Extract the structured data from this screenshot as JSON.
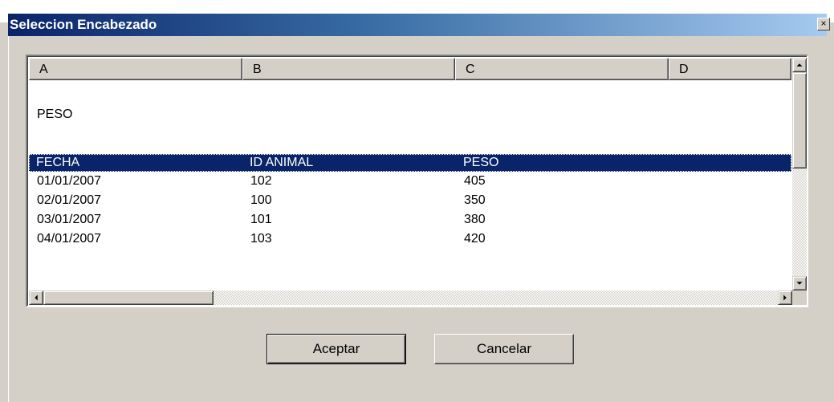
{
  "window": {
    "title": "Seleccion Encabezado",
    "close_label": "×"
  },
  "listview": {
    "columns": [
      "A",
      "B",
      "C",
      "D"
    ],
    "rows": [
      [
        "",
        "",
        ""
      ],
      [
        "PESO",
        "",
        ""
      ],
      [
        "",
        "",
        ""
      ],
      [
        "FECHA",
        "ID ANIMAL",
        "PESO"
      ],
      [
        "01/01/2007",
        "102",
        "405"
      ],
      [
        "02/01/2007",
        "100",
        "350"
      ],
      [
        "03/01/2007",
        "101",
        "380"
      ],
      [
        "04/01/2007",
        "103",
        "420"
      ]
    ],
    "selected_row": 3
  },
  "buttons": {
    "ok_label": "Aceptar",
    "cancel_label": "Cancelar"
  },
  "colors": {
    "title_bar_start": "#0a246a",
    "title_bar_end": "#a6caf0",
    "selection": "#0a246a",
    "face": "#d4d0c8"
  }
}
